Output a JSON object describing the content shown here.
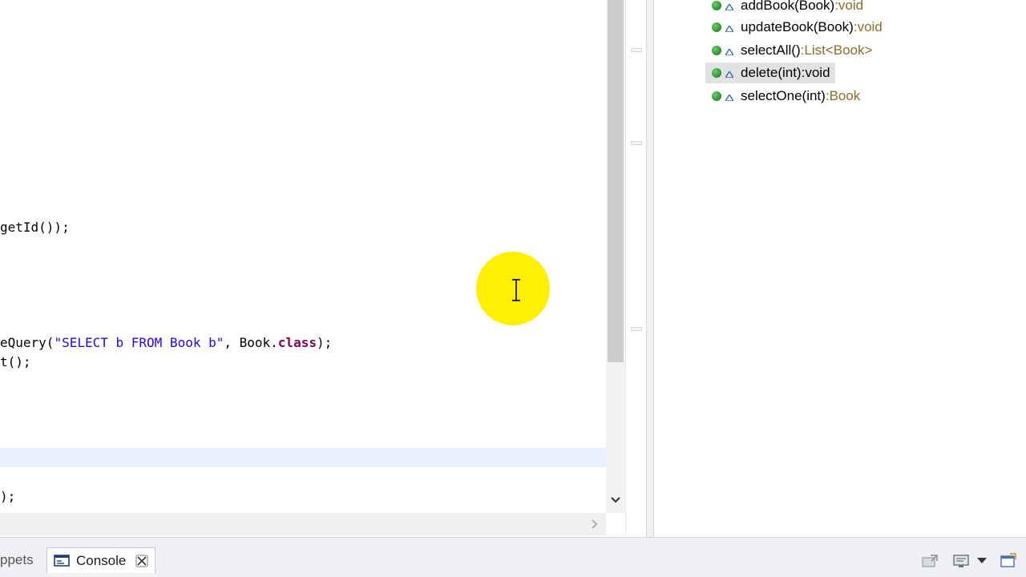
{
  "editor": {
    "lines": [
      {
        "parts": [
          {
            "text": "getId());",
            "cls": ""
          }
        ]
      },
      {
        "parts": [
          {
            "text": "eQuery(",
            "cls": ""
          },
          {
            "text": "\"SELECT b FROM Book b\"",
            "cls": "tok-str"
          },
          {
            "text": ", Book.",
            "cls": ""
          },
          {
            "text": "class",
            "cls": "tok-kw"
          },
          {
            "text": ");",
            "cls": ""
          }
        ]
      },
      {
        "parts": [
          {
            "text": "t();",
            "cls": ""
          }
        ]
      },
      {
        "parts": [
          {
            "text": ");",
            "cls": ""
          }
        ]
      }
    ]
  },
  "outline": {
    "methods": [
      {
        "name": "addBook(Book)",
        "sep": " : ",
        "ret": "void"
      },
      {
        "name": "updateBook(Book)",
        "sep": " : ",
        "ret": "void"
      },
      {
        "name": "selectAll()",
        "sep": " : ",
        "ret": "List<Book>"
      },
      {
        "name": "delete(int)",
        "sep": " : ",
        "ret": "void"
      },
      {
        "name": "selectOne(int)",
        "sep": " : ",
        "ret": "Book"
      }
    ]
  },
  "bottom_bar": {
    "snippets_label": "ppets",
    "console_label": "Console"
  },
  "colors": {
    "string": "#2a00ff",
    "keyword": "#7f0055",
    "return_type": "#8c6a2e",
    "cursor_highlight": "#ffef00"
  }
}
